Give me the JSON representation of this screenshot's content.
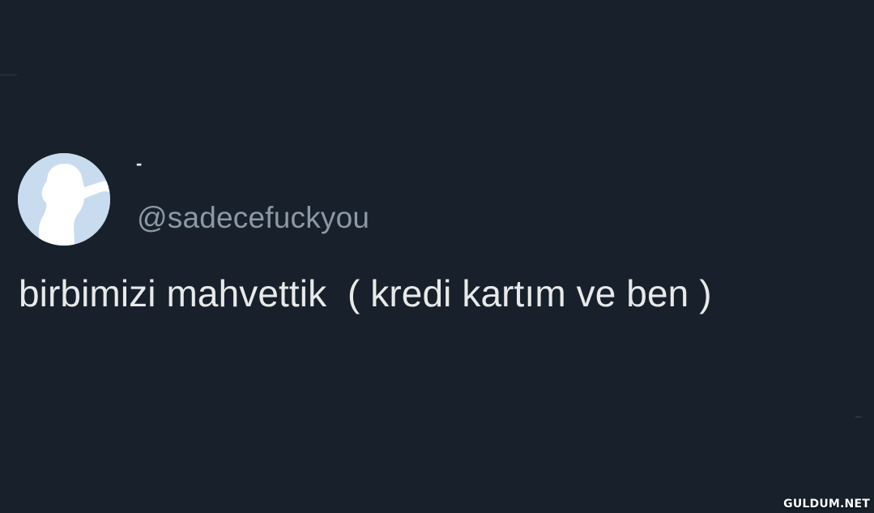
{
  "tweet": {
    "display_name": "-",
    "handle": "@sadecefuckyou",
    "text": "birbimizi mahvettik  ( kredi kartım ve ben )",
    "avatar_icon": "person-silhouette-pointing-icon"
  },
  "watermark": {
    "text": "GULDUM.NET"
  },
  "colors": {
    "background": "#17202b",
    "primary_text": "#e7e9ea",
    "secondary_text": "#8b98a5",
    "avatar_background": "#c9dcef",
    "avatar_silhouette": "#ffffff"
  }
}
